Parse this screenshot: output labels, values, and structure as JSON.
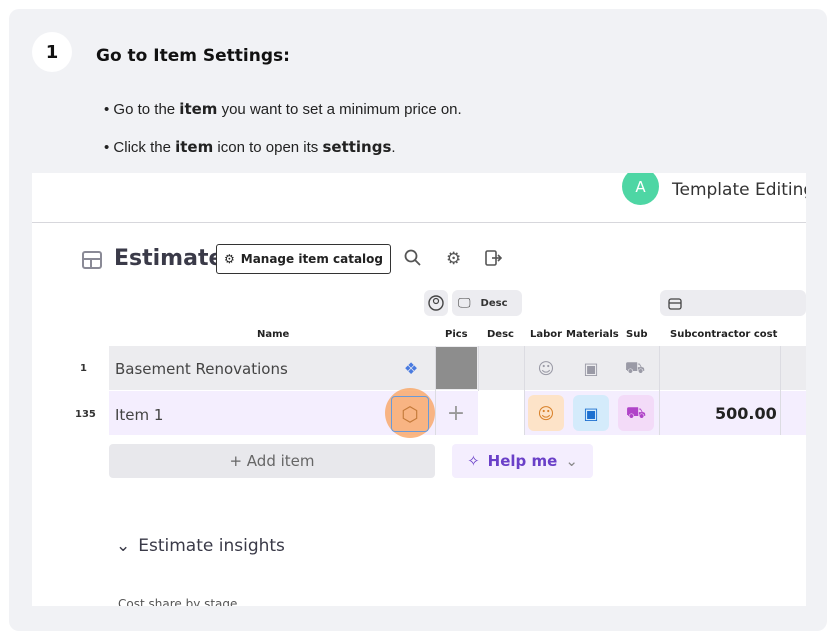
{
  "step": {
    "number": "1",
    "title": "Go to Item Settings:",
    "bullets": [
      {
        "prefix": "• Go to the ",
        "bold": "item",
        "suffix": " you want to set a minimum price on."
      },
      {
        "prefix": "• Click the ",
        "bold": "item",
        "middle": " icon to open its ",
        "bold2": "settings",
        "suffix": "."
      }
    ]
  },
  "screenshot": {
    "topbar": {
      "avatar_letter": "A",
      "title": "Template Editing"
    },
    "toolbar": {
      "title": "Estimate",
      "catalog_button": "Manage item catalog"
    },
    "column_pills": {
      "desc": "Desc"
    },
    "columns": [
      "Name",
      "Pics",
      "Desc",
      "Labor",
      "Materials",
      "Sub",
      "Subcontractor cost"
    ],
    "rows": [
      {
        "num": "1",
        "name": "Basement Renovations",
        "cost": ""
      },
      {
        "num": "135",
        "name": "Item 1",
        "cost": "500.00"
      }
    ],
    "add_item": "+ Add item",
    "help_me": "Help me",
    "insights_title": "Estimate insights",
    "cost_share": "Cost share by stage"
  },
  "colors": {
    "accent": "#6a40c8",
    "highlight_row": "#f4eefe",
    "avatar": "#4ed6a4",
    "click_indicator": "#f9a05a"
  }
}
